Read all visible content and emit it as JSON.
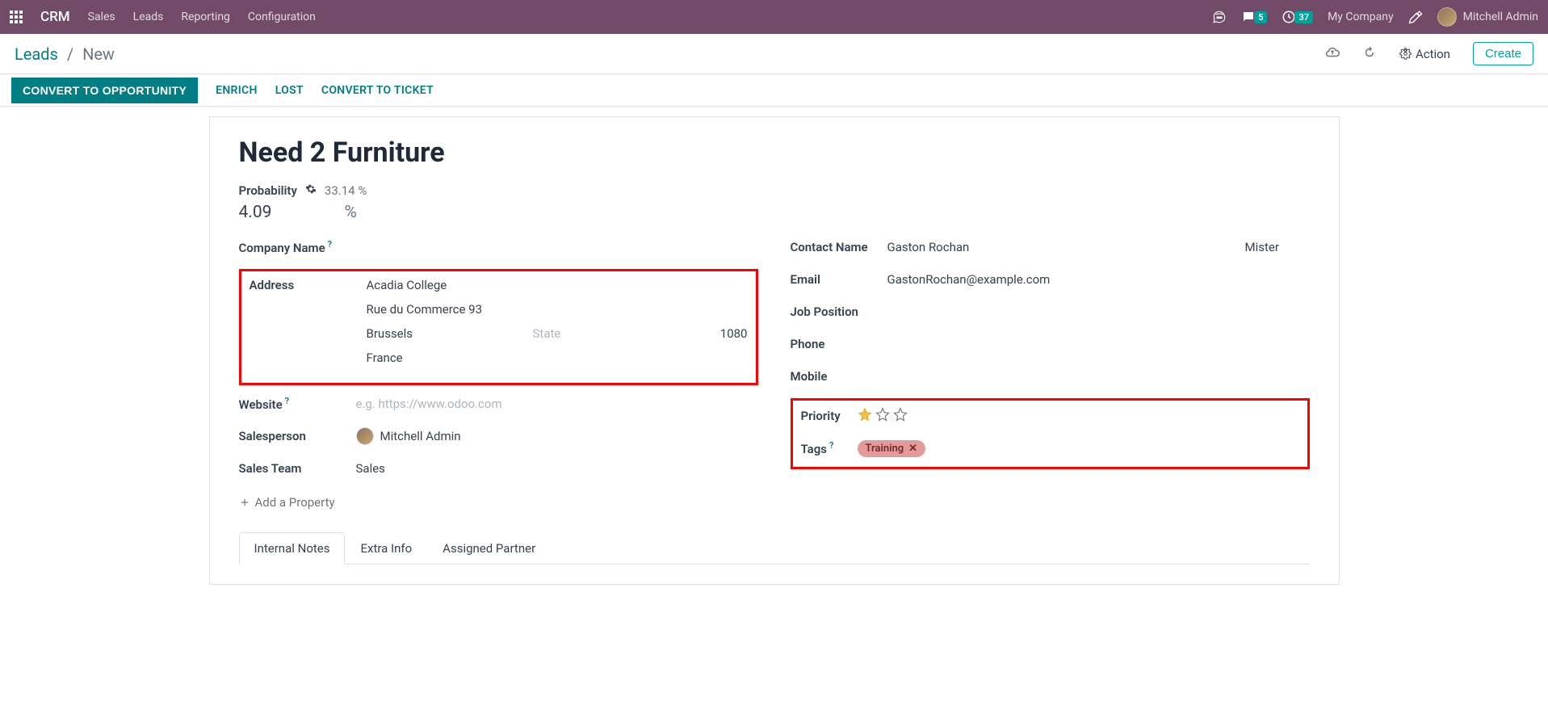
{
  "topbar": {
    "brand": "CRM",
    "nav": [
      "Sales",
      "Leads",
      "Reporting",
      "Configuration"
    ],
    "messages_badge": "5",
    "activities_badge": "37",
    "company": "My Company",
    "user": "Mitchell Admin"
  },
  "breadcrumb": {
    "parent": "Leads",
    "current": "New",
    "action_label": "Action",
    "create_label": "Create"
  },
  "actions": {
    "convert_opportunity": "CONVERT TO OPPORTUNITY",
    "enrich": "ENRICH",
    "lost": "LOST",
    "convert_ticket": "CONVERT TO TICKET"
  },
  "lead": {
    "title": "Need 2 Furniture",
    "probability_label": "Probability",
    "probability_auto": "33.14 %",
    "probability_value": "4.09",
    "probability_unit": "%",
    "company_name_label": "Company Name",
    "address_label": "Address",
    "address": {
      "street": "Acadia College",
      "street2": "Rue du Commerce 93",
      "city": "Brussels",
      "state_placeholder": "State",
      "zip": "1080",
      "country": "France"
    },
    "website_label": "Website",
    "website_placeholder": "e.g. https://www.odoo.com",
    "salesperson_label": "Salesperson",
    "salesperson_value": "Mitchell Admin",
    "sales_team_label": "Sales Team",
    "sales_team_value": "Sales",
    "add_property": "Add a Property",
    "contact_name_label": "Contact Name",
    "contact_name_value": "Gaston Rochan",
    "contact_title": "Mister",
    "email_label": "Email",
    "email_value": "GastonRochan@example.com",
    "job_position_label": "Job Position",
    "phone_label": "Phone",
    "mobile_label": "Mobile",
    "priority_label": "Priority",
    "priority_value": 1,
    "tags_label": "Tags",
    "tag_value": "Training"
  },
  "tabs": {
    "internal_notes": "Internal Notes",
    "extra_info": "Extra Info",
    "assigned_partner": "Assigned Partner"
  }
}
